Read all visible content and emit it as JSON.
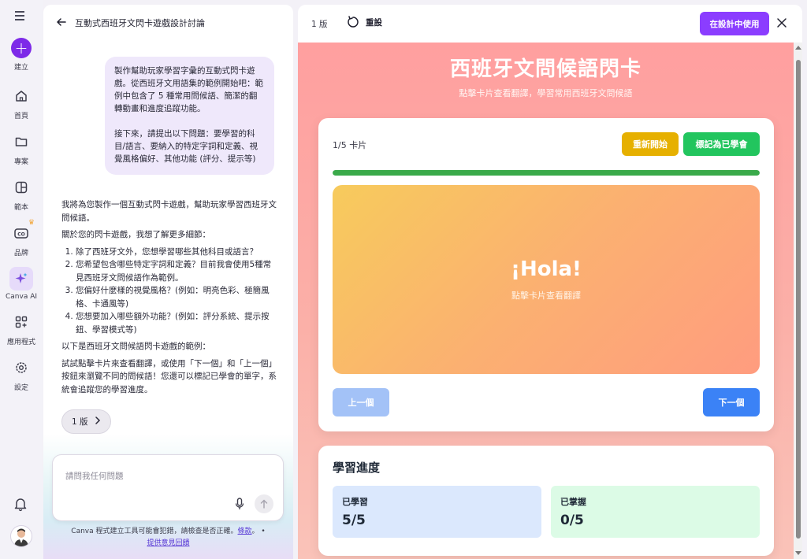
{
  "rail": {
    "create_label": "建立",
    "items": [
      {
        "label": "首頁",
        "icon": "home-icon"
      },
      {
        "label": "專案",
        "icon": "folder-icon"
      },
      {
        "label": "範本",
        "icon": "template-icon"
      },
      {
        "label": "品牌",
        "icon": "brand-icon"
      },
      {
        "label": "Canva AI",
        "icon": "sparkle-icon"
      },
      {
        "label": "應用程式",
        "icon": "apps-icon"
      },
      {
        "label": "設定",
        "icon": "gear-icon"
      }
    ]
  },
  "chat": {
    "title": "互動式西班牙文閃卡遊戲設計討論",
    "user_message": {
      "p1": "製作幫助玩家學習字彙的互動式閃卡遊戲。從西班牙文用語集的範例開始吧：範例中包含了 5 種常用問候語、簡潔的翻轉動畫和進度追蹤功能。",
      "p2": "接下來，請提出以下問題：要學習的科目/語言、要納入的特定字詞和定義、視覺風格偏好、其他功能 (評分、提示等)"
    },
    "assistant": {
      "intro": "我將為您製作一個互動式閃卡遊戲，幫助玩家學習西班牙文問候語。",
      "ask": "關於您的閃卡遊戲，我想了解更多細節：",
      "questions": [
        "除了西班牙文外，您想學習哪些其他科目或語言？",
        "您希望包含哪些特定字詞和定義？目前我會使用5種常見西班牙文問候語作為範例。",
        "您偏好什麼樣的視覺風格？(例如：明亮色彩、極簡風格、卡通風等)",
        "您想要加入哪些額外功能？(例如：評分系統、提示按鈕、學習模式等)"
      ],
      "example_intro": "以下是西班牙文問候語閃卡遊戲的範例：",
      "instructions": "試試點擊卡片來查看翻譯，或使用「下一個」和「上一個」按鈕來瀏覽不同的問候語！您還可以標記已學會的單字，系統會追蹤您的學習進度。"
    },
    "version_button": "1 版",
    "input_placeholder": "請問我任何問題",
    "disclaimer_text": "Canva 程式建立工具可能會犯錯，請檢查是否正確。",
    "terms_link": "條款",
    "feedback_link": "提供意見回饋"
  },
  "preview": {
    "version_label": "1 版",
    "reset_label": "重設",
    "use_in_design": "在設計中使用",
    "app": {
      "title": "西班牙文問候語閃卡",
      "subtitle": "點擊卡片查看翻譯，學習常用西班牙文問候語",
      "counter": "1/5 卡片",
      "restart": "重新開始",
      "mark_learned": "標記為已學會",
      "progress_fraction": 1.0,
      "card_word": "¡Hola!",
      "card_hint": "點擊卡片查看翻譯",
      "prev": "上一個",
      "next": "下一個",
      "progress_title": "學習進度",
      "learned_label": "已學習",
      "learned_value": "5/5",
      "mastered_label": "已掌握",
      "mastered_value": "0/5"
    }
  },
  "colors": {
    "brand_purple": "#8b3dff",
    "app_bg_top": "#ff9f9f",
    "restart": "#e6b000",
    "learned": "#22c55e",
    "next": "#3b82f6"
  }
}
